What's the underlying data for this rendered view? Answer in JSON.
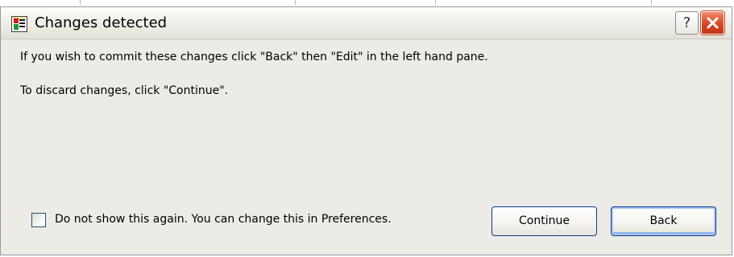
{
  "dialog": {
    "title": "Changes detected",
    "help_button": "?",
    "close_icon": "close-icon",
    "app_icon": "app-icon"
  },
  "messages": {
    "line1": "If you wish to commit these changes click \"Back\" then \"Edit\" in the left hand pane.",
    "line2": "To discard changes, click \"Continue\"."
  },
  "checkbox": {
    "label": "Do not show this again. You can change this in Preferences.",
    "checked": false
  },
  "buttons": {
    "continue_label": "Continue",
    "back_label": "Back",
    "default": "back"
  },
  "colors": {
    "dialog_bg": "#ecebe6",
    "close_button": "#d94b2c",
    "button_border": "#0b3c93"
  }
}
